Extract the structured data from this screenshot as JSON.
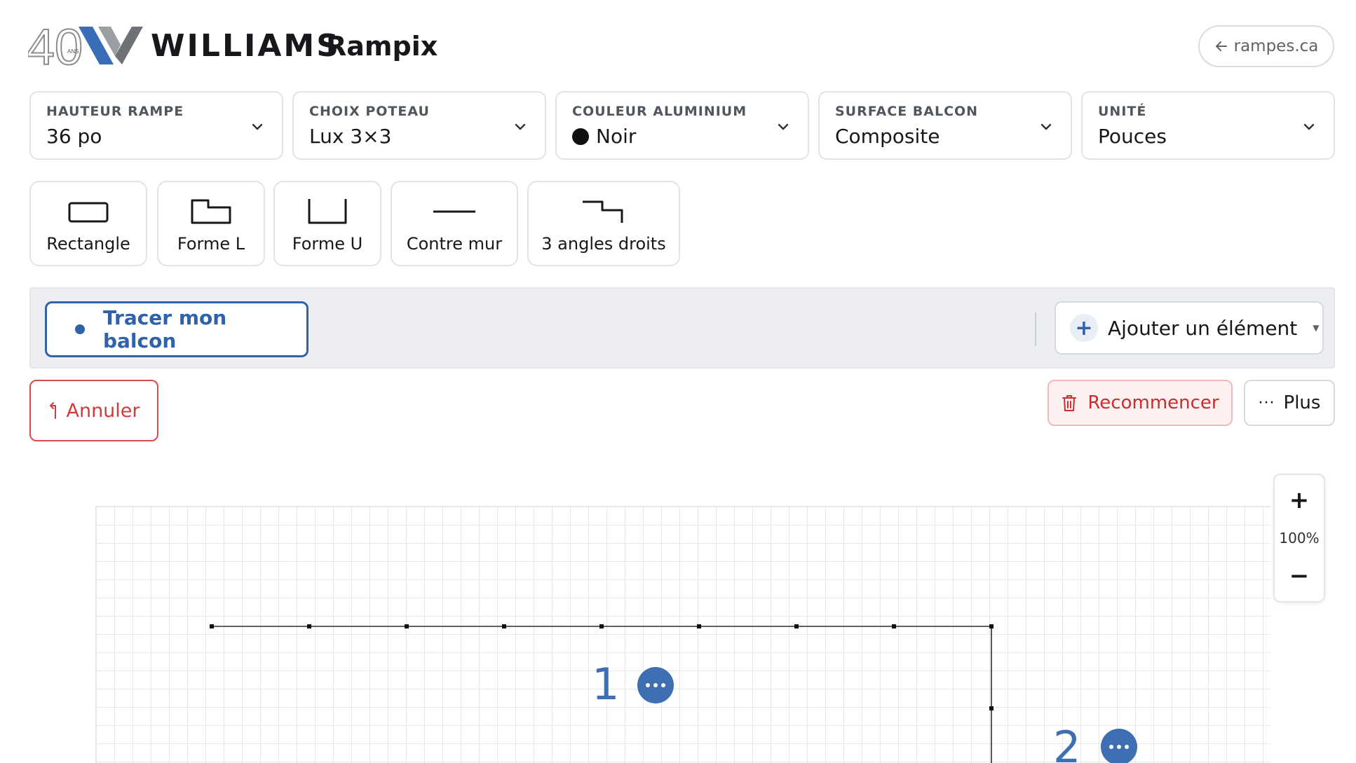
{
  "header": {
    "logo_years": "40",
    "logo_ans": "ANS",
    "brand": "WILLIAMS",
    "product": "Rampix",
    "site_link": "rampes.ca"
  },
  "dropdowns": [
    {
      "label": "HAUTEUR RAMPE",
      "value": "36 po"
    },
    {
      "label": "CHOIX POTEAU",
      "value": "Lux 3×3"
    },
    {
      "label": "COULEUR ALUMINIUM",
      "value": "Noir",
      "swatch": "#111111"
    },
    {
      "label": "SURFACE BALCON",
      "value": "Composite"
    },
    {
      "label": "UNITÉ",
      "value": "Pouces"
    }
  ],
  "shapes": [
    {
      "label": "Rectangle",
      "icon": "rectangle-shape-icon"
    },
    {
      "label": "Forme L",
      "icon": "l-shape-icon"
    },
    {
      "label": "Forme U",
      "icon": "u-shape-icon"
    },
    {
      "label": "Contre mur",
      "icon": "wall-line-icon"
    },
    {
      "label": "3 angles droits",
      "icon": "three-right-angles-icon"
    }
  ],
  "toolbar": {
    "trace_label": "Tracer mon balcon",
    "add_label": "Ajouter un élément",
    "add_icon": "plus-icon"
  },
  "actions": {
    "undo_label": "Annuler",
    "reset_label": "Recommencer",
    "more_label": "Plus"
  },
  "zoom": {
    "in_label": "+",
    "level": "100%",
    "out_label": "−"
  },
  "segments": [
    {
      "number": "1"
    },
    {
      "number": "2"
    }
  ],
  "colors": {
    "accent": "#2f62a9",
    "danger": "#d13b3b",
    "segment": "#3f6fb3"
  }
}
